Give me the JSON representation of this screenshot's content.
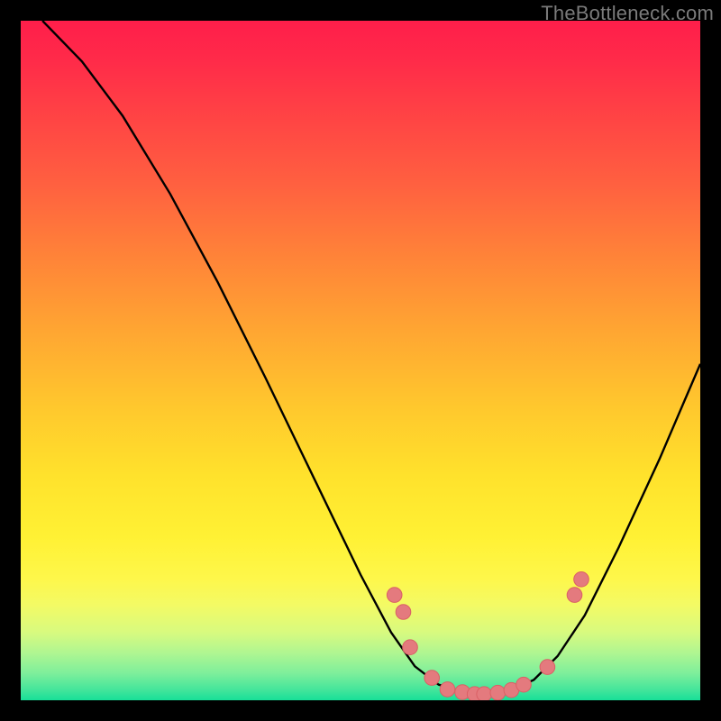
{
  "watermark": "TheBottleneck.com",
  "colors": {
    "frame": "#000000",
    "curve": "#000000",
    "marker_fill": "#e47a7e",
    "marker_stroke": "#da6065"
  },
  "chart_data": {
    "type": "line",
    "title": "",
    "xlabel": "",
    "ylabel": "",
    "xlim": [
      0,
      100
    ],
    "ylim": [
      0,
      100
    ],
    "note": "Axes are implicit (no ticks/labels rendered). Values below are estimated pixel-to-percent readings of the bottleneck curve where y=0 is the bottom (green) and y=100 is the top (red).",
    "curve": [
      {
        "x": 3.2,
        "y": 100.0
      },
      {
        "x": 9.0,
        "y": 94.0
      },
      {
        "x": 15.0,
        "y": 86.0
      },
      {
        "x": 22.0,
        "y": 74.5
      },
      {
        "x": 29.0,
        "y": 61.5
      },
      {
        "x": 36.0,
        "y": 47.5
      },
      {
        "x": 43.0,
        "y": 33.0
      },
      {
        "x": 50.0,
        "y": 18.5
      },
      {
        "x": 54.5,
        "y": 10.0
      },
      {
        "x": 58.0,
        "y": 5.0
      },
      {
        "x": 61.5,
        "y": 2.3
      },
      {
        "x": 65.0,
        "y": 1.2
      },
      {
        "x": 68.5,
        "y": 1.0
      },
      {
        "x": 72.0,
        "y": 1.4
      },
      {
        "x": 75.5,
        "y": 3.0
      },
      {
        "x": 79.0,
        "y": 6.5
      },
      {
        "x": 83.0,
        "y": 12.5
      },
      {
        "x": 88.0,
        "y": 22.5
      },
      {
        "x": 94.0,
        "y": 35.5
      },
      {
        "x": 100.0,
        "y": 49.5
      }
    ],
    "markers": [
      {
        "x": 55.0,
        "y": 15.5
      },
      {
        "x": 56.3,
        "y": 13.0
      },
      {
        "x": 57.3,
        "y": 7.8
      },
      {
        "x": 60.5,
        "y": 3.3
      },
      {
        "x": 62.8,
        "y": 1.6
      },
      {
        "x": 65.0,
        "y": 1.2
      },
      {
        "x": 66.8,
        "y": 0.9
      },
      {
        "x": 68.2,
        "y": 0.9
      },
      {
        "x": 70.2,
        "y": 1.1
      },
      {
        "x": 72.2,
        "y": 1.5
      },
      {
        "x": 74.0,
        "y": 2.3
      },
      {
        "x": 77.5,
        "y": 4.9
      },
      {
        "x": 81.5,
        "y": 15.5
      },
      {
        "x": 82.5,
        "y": 17.8
      }
    ],
    "marker_radius_percent": 1.1
  }
}
